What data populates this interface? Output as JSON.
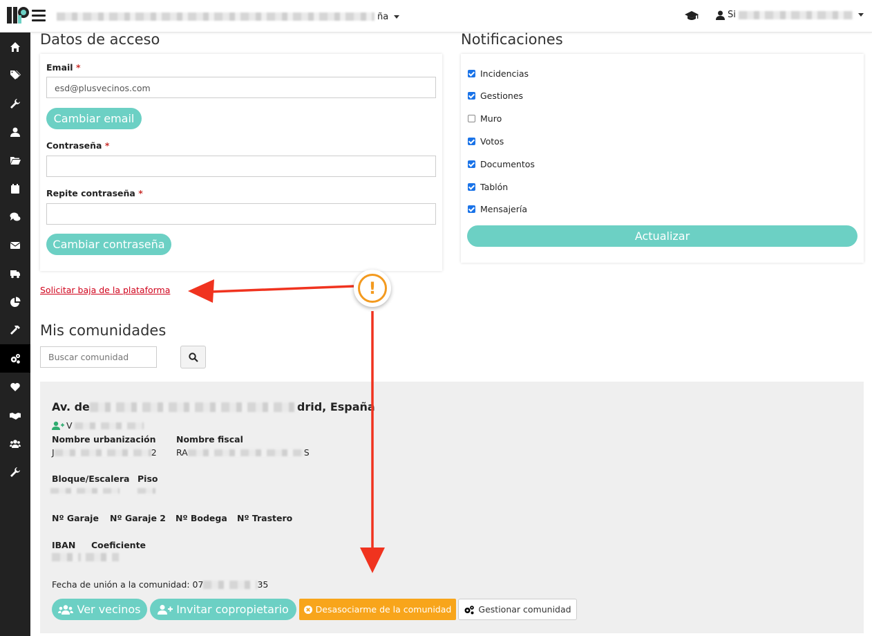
{
  "topbar": {
    "breadcrumb_visible_suffix": "ña",
    "user_prefix": "Si"
  },
  "sidebar": {
    "items": [
      {
        "icon": "home-icon"
      },
      {
        "icon": "tags-icon"
      },
      {
        "icon": "wrench-icon"
      },
      {
        "icon": "user-icon"
      },
      {
        "icon": "folder-open-icon"
      },
      {
        "icon": "calendar-icon"
      },
      {
        "icon": "comments-icon"
      },
      {
        "icon": "envelope-icon"
      },
      {
        "icon": "truck-icon"
      },
      {
        "icon": "pie-chart-icon"
      },
      {
        "icon": "hammer-icon"
      },
      {
        "icon": "cogs-icon",
        "active": true
      },
      {
        "icon": "heart-icon"
      },
      {
        "icon": "handshake-icon"
      },
      {
        "icon": "users-icon"
      },
      {
        "icon": "wrench-icon"
      }
    ]
  },
  "access": {
    "heading": "Datos de acceso",
    "email_label": "Email",
    "email_value": "esd@plusvecinos.com",
    "change_email": "Cambiar email",
    "password_label": "Contraseña",
    "repeat_password_label": "Repite contraseña",
    "required_mark": "*",
    "change_password": "Cambiar contraseña"
  },
  "notifications": {
    "heading": "Notificaciones",
    "items": [
      {
        "label": "Incidencias",
        "checked": true
      },
      {
        "label": "Gestiones",
        "checked": true
      },
      {
        "label": "Muro",
        "checked": false
      },
      {
        "label": "Votos",
        "checked": true
      },
      {
        "label": "Documentos",
        "checked": true
      },
      {
        "label": "Tablón",
        "checked": true
      },
      {
        "label": "Mensajería",
        "checked": true
      }
    ],
    "update": "Actualizar"
  },
  "unsubscribe_link": "Solicitar baja de la plataforma",
  "communities": {
    "heading": "Mis comunidades",
    "search_placeholder": "Buscar comunidad",
    "card": {
      "title_prefix": "Av. de",
      "title_suffix": "drid, España",
      "owner_prefix": "V",
      "urbanization_label": "Nombre urbanización",
      "urbanization_prefix": "J",
      "urbanization_suffix": "2",
      "fiscal_label": "Nombre fiscal",
      "fiscal_prefix": "RA",
      "fiscal_suffix": "S",
      "block_label": "Bloque/Escalera",
      "floor_label": "Piso",
      "garage_label": "Nº Garaje",
      "garage2_label": "Nº Garaje 2",
      "cellar_label": "Nº Bodega",
      "storage_label": "Nº Trastero",
      "iban_label": "IBAN",
      "coef_label": "Coeficiente",
      "join_date_label": "Fecha de unión a la comunidad: 07",
      "join_date_suffix": "35",
      "btn_neighbors": "Ver vecinos",
      "btn_invite": "Invitar copropietario",
      "btn_leave": "Desasociarme de la comunidad",
      "btn_manage": "Gestionar comunidad"
    }
  },
  "annotation": {
    "warning_glyph": "!",
    "arrow_color": "#f0331f"
  }
}
